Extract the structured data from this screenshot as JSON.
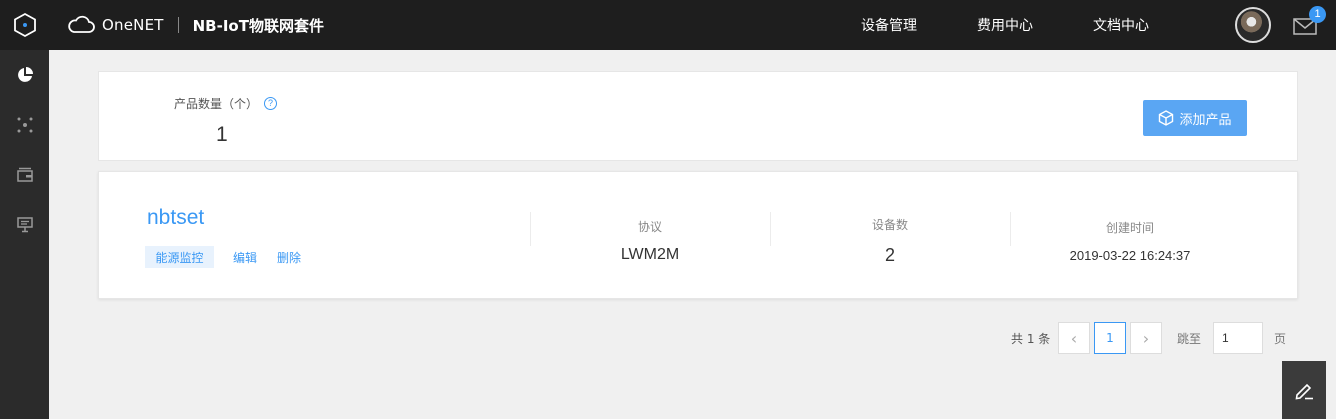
{
  "topbar": {
    "brand": "OneNET",
    "suite": "NB-IoT物联网套件",
    "nav": [
      "设备管理",
      "费用中心",
      "文档中心"
    ],
    "unread_count": "1"
  },
  "summary": {
    "count_label": "产品数量（个）",
    "help": "?",
    "count_value": "1",
    "add_button": "添加产品"
  },
  "product": {
    "name": "nbtset",
    "tag": "能源监控",
    "edit": "编辑",
    "delete": "删除",
    "protocol_label": "协议",
    "protocol_value": "LWM2M",
    "devices_label": "设备数",
    "devices_value": "2",
    "created_label": "创建时间",
    "created_value": "2019-03-22 16:24:37"
  },
  "pager": {
    "total": "共 1 条",
    "prev": "‹",
    "current": "1",
    "next": "›",
    "goto_label": "跳至",
    "goto_value": "1",
    "page_suffix": "页"
  },
  "colors": {
    "accent": "#3a98f4",
    "topbar_bg": "#1e1e1e",
    "sidebar_bg": "#2b2b2b"
  }
}
